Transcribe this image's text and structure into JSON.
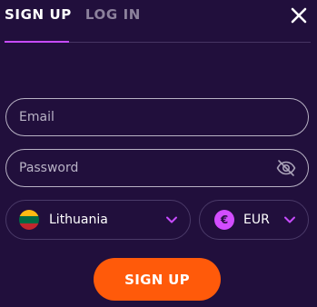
{
  "tabs": [
    {
      "label": "SIGN UP",
      "active": true
    },
    {
      "label": "LOG IN",
      "active": false
    }
  ],
  "close_icon": "close-icon",
  "form": {
    "email": {
      "placeholder": "Email",
      "value": ""
    },
    "password": {
      "placeholder": "Password",
      "value": "",
      "icon": "eye-off-icon"
    },
    "country": {
      "selected": "Lithuania",
      "flag_icon": "lithuania-flag-icon"
    },
    "currency": {
      "selected": "EUR",
      "icon": "euro-coin-icon",
      "symbol": "€"
    },
    "submit_label": "SIGN UP"
  },
  "colors": {
    "background": "#210f3c",
    "accent": "#c74bff",
    "button": "#ff5a0a",
    "field_border": "#b8b2c4"
  }
}
